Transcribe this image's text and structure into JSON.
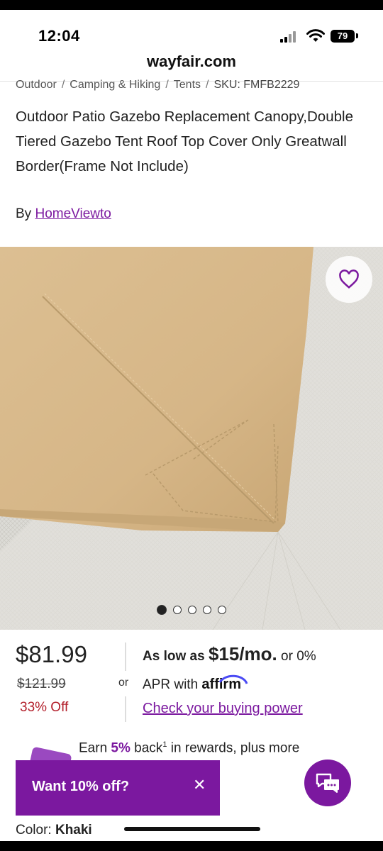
{
  "status_bar": {
    "time": "12:04",
    "battery": "79"
  },
  "browser": {
    "url": "wayfair.com"
  },
  "breadcrumb": {
    "items": [
      "Outdoor",
      "Camping & Hiking",
      "Tents"
    ],
    "separator": "/",
    "sku": "SKU: FMFB2229"
  },
  "product": {
    "title": "Outdoor Patio Gazebo Replacement Canopy,Double Tiered Gazebo Tent Roof Top Cover Only Greatwall Border(Frame Not Include)",
    "by_label": "By",
    "brand": "HomeViewto"
  },
  "gallery": {
    "total_images": 5,
    "active_index": 0
  },
  "pricing": {
    "price": "$81.99",
    "was_price": "$121.99",
    "discount": "33% Off",
    "or": "or",
    "affirm_prefix": "As low as",
    "affirm_amount": "$15/mo.",
    "affirm_suffix": "or 0%",
    "apr_text": "APR with",
    "affirm_brand": "affirm",
    "check_power": "Check your buying power"
  },
  "rewards": {
    "prefix": "Earn",
    "percent": "5%",
    "text_a": "back",
    "sup": "1",
    "text_b": "in rewards, plus more"
  },
  "promo": {
    "text": "Want 10% off?",
    "close": "✕"
  },
  "options": {
    "color_label": "Color:",
    "color_value": "Khaki"
  },
  "colors": {
    "brand_purple": "#7b189f",
    "discount_red": "#b3202c",
    "canopy_khaki": "#d8b888"
  }
}
